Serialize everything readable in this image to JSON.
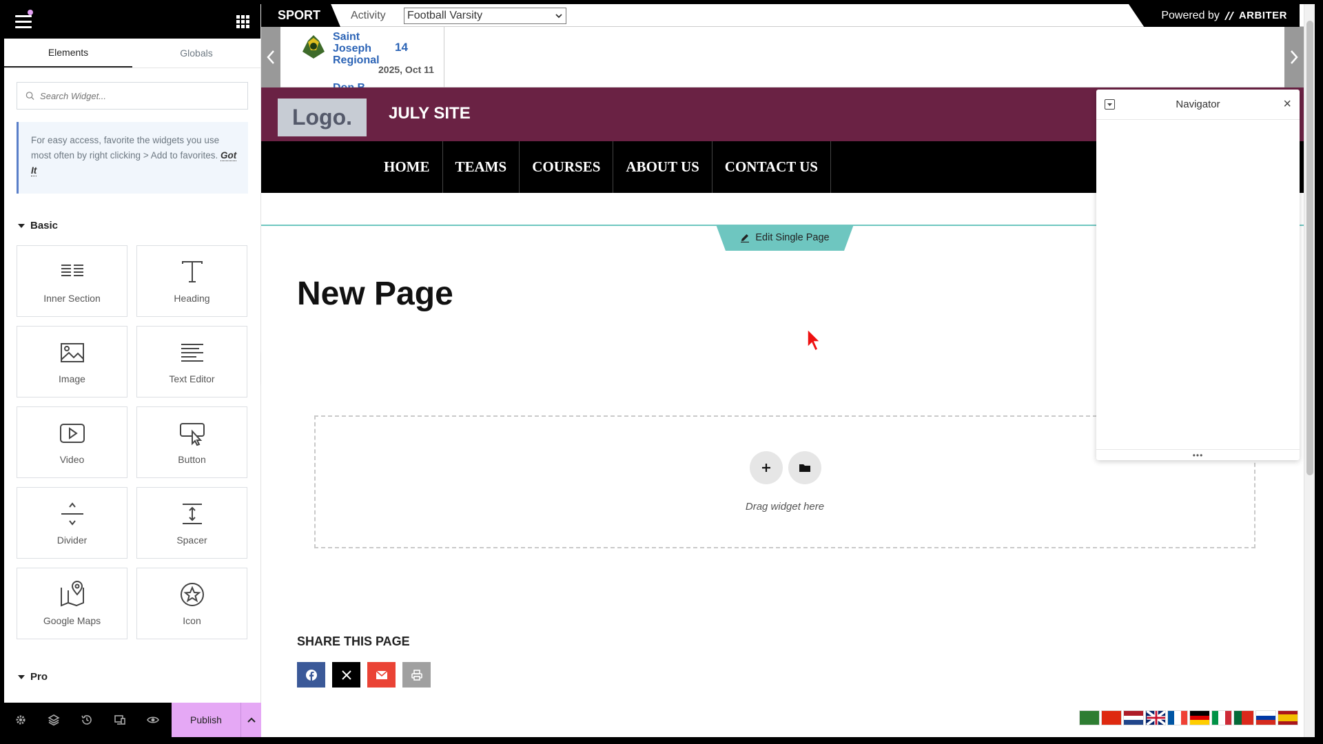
{
  "panel": {
    "tabs": [
      {
        "label": "Elements"
      },
      {
        "label": "Globals"
      }
    ],
    "search_placeholder": "Search Widget...",
    "tip_text": "For easy access, favorite the widgets you use most often by right clicking > Add to favorites.",
    "tip_action": "Got It",
    "basic_label": "Basic",
    "pro_label": "Pro",
    "widgets": [
      {
        "label": "Inner Section",
        "icon": "inner-section-icon"
      },
      {
        "label": "Heading",
        "icon": "heading-icon"
      },
      {
        "label": "Image",
        "icon": "image-icon"
      },
      {
        "label": "Text Editor",
        "icon": "text-editor-icon"
      },
      {
        "label": "Video",
        "icon": "video-icon"
      },
      {
        "label": "Button",
        "icon": "button-icon"
      },
      {
        "label": "Divider",
        "icon": "divider-icon"
      },
      {
        "label": "Spacer",
        "icon": "spacer-icon"
      },
      {
        "label": "Google Maps",
        "icon": "google-maps-icon"
      },
      {
        "label": "Icon",
        "icon": "star-icon"
      }
    ],
    "publish_label": "Publish",
    "accent_color": "#e5a8f5"
  },
  "sportbar": {
    "sport_label": "SPORT",
    "activity_label": "Activity",
    "activity_value": "Football Varsity",
    "powered_label": "Powered by",
    "powered_brand": "ARBITER"
  },
  "scoreboard": {
    "team_name": "Saint Joseph Regional",
    "team_score": "14",
    "game_date": "2025, Oct 11",
    "team2_partial": "Don B"
  },
  "site": {
    "logo_text": "Logo.",
    "title": "JULY SITE",
    "header_color": "#6a2244",
    "nav": [
      "HOME",
      "TEAMS",
      "COURSES",
      "ABOUT US",
      "CONTACT US"
    ]
  },
  "content": {
    "edit_label": "Edit Single Page",
    "page_title": "New Page",
    "drop_text": "Drag widget here",
    "share_title": "SHARE THIS PAGE"
  },
  "navigator": {
    "title": "Navigator"
  }
}
